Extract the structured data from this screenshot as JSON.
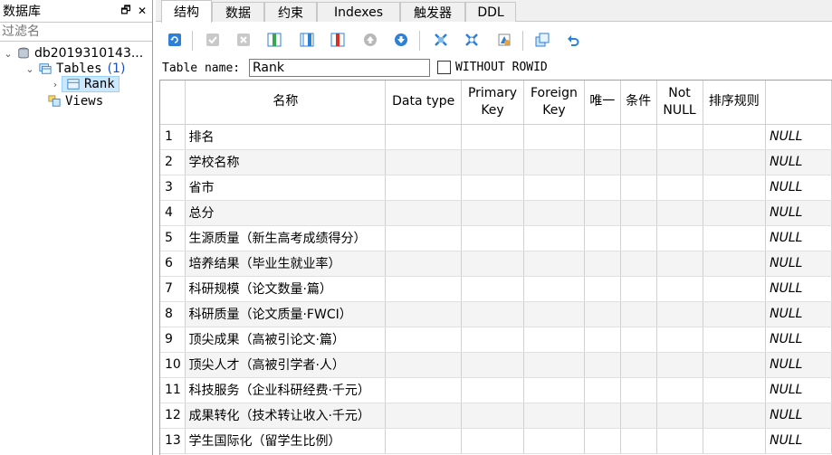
{
  "left_panel": {
    "title": "数据库",
    "pin_glyph": "🗗",
    "close_glyph": "✕",
    "filter_placeholder": "过滤名",
    "database": "db2019310143...",
    "tables_label": "Tables",
    "tables_count": "(1)",
    "table_name": "Rank",
    "views_label": "Views"
  },
  "tabs": [
    "结构",
    "数据",
    "约束",
    "Indexes",
    "触发器",
    "DDL"
  ],
  "active_tab": 0,
  "toolbar_icons": [
    "refresh-icon",
    "commit-icon",
    "rollback-icon",
    "add-column-icon",
    "insert-column-icon",
    "delete-column-icon",
    "move-up-icon",
    "move-down-icon",
    "primary-key-icon",
    "foreign-key-icon",
    "unique-icon",
    "copy-ddl-icon",
    "undo-icon"
  ],
  "table_name_label": "Table name:",
  "table_name_value": "Rank",
  "without_rowid_label": "WITHOUT ROWID",
  "without_rowid_checked": false,
  "columns": [
    "名称",
    "Data type",
    "Primary Key",
    "Foreign Key",
    "唯一",
    "条件",
    "Not NULL",
    "排序规则"
  ],
  "rows": [
    {
      "n": "1",
      "name": "排名",
      "default": "NULL"
    },
    {
      "n": "2",
      "name": "学校名称",
      "default": "NULL"
    },
    {
      "n": "3",
      "name": "省市",
      "default": "NULL"
    },
    {
      "n": "4",
      "name": "总分",
      "default": "NULL"
    },
    {
      "n": "5",
      "name": "生源质量（新生高考成绩得分）",
      "default": "NULL"
    },
    {
      "n": "6",
      "name": "培养结果（毕业生就业率）",
      "default": "NULL"
    },
    {
      "n": "7",
      "name": "科研规模（论文数量·篇）",
      "default": "NULL"
    },
    {
      "n": "8",
      "name": "科研质量（论文质量·FWCI）",
      "default": "NULL"
    },
    {
      "n": "9",
      "name": "顶尖成果（高被引论文·篇）",
      "default": "NULL"
    },
    {
      "n": "10",
      "name": "顶尖人才（高被引学者·人）",
      "default": "NULL"
    },
    {
      "n": "11",
      "name": "科技服务（企业科研经费·千元）",
      "default": "NULL"
    },
    {
      "n": "12",
      "name": "成果转化（技术转让收入·千元）",
      "default": "NULL"
    },
    {
      "n": "13",
      "name": "学生国际化（留学生比例）",
      "default": "NULL"
    }
  ],
  "colors": {
    "accent": "#1a4fbd",
    "selection": "#cce8ff",
    "alt_row": "#f4f4f4"
  }
}
